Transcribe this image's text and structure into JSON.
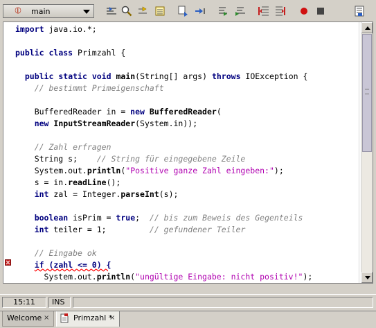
{
  "toolbar": {
    "method_selector": {
      "value": "main",
      "icon": "method-icon"
    },
    "buttons": [
      {
        "name": "find-selection-icon"
      },
      {
        "name": "find-icon"
      },
      {
        "name": "goto-previous-icon"
      },
      {
        "name": "bookmarks-icon"
      },
      {
        "name": "replace-icon"
      },
      {
        "name": "goto-next-icon"
      },
      {
        "name": "shift-left-icon"
      },
      {
        "name": "shift-right-icon"
      },
      {
        "name": "comment-icon"
      },
      {
        "name": "uncomment-icon"
      },
      {
        "name": "record-macro-icon"
      },
      {
        "name": "stop-macro-icon"
      },
      {
        "name": "macro-list-icon"
      }
    ]
  },
  "editor": {
    "lines": [
      {
        "parts": [
          {
            "t": "import",
            "c": "kw"
          },
          {
            "t": " java.io.*;"
          }
        ]
      },
      {
        "parts": []
      },
      {
        "parts": [
          {
            "t": "public",
            "c": "kw"
          },
          {
            "t": " "
          },
          {
            "t": "class",
            "c": "kw"
          },
          {
            "t": " Primzahl {"
          }
        ]
      },
      {
        "parts": []
      },
      {
        "parts": [
          {
            "t": "  "
          },
          {
            "t": "public",
            "c": "kw"
          },
          {
            "t": " "
          },
          {
            "t": "static",
            "c": "kw"
          },
          {
            "t": " "
          },
          {
            "t": "void",
            "c": "kw"
          },
          {
            "t": " "
          },
          {
            "t": "main",
            "c": "mb"
          },
          {
            "t": "(String[] args) "
          },
          {
            "t": "throws",
            "c": "kw"
          },
          {
            "t": " IOException {"
          }
        ]
      },
      {
        "parts": [
          {
            "t": "    "
          },
          {
            "t": "// bestimmt Primeigenschaft",
            "c": "cm"
          }
        ]
      },
      {
        "parts": []
      },
      {
        "parts": [
          {
            "t": "    BufferedReader in = "
          },
          {
            "t": "new",
            "c": "kw"
          },
          {
            "t": " "
          },
          {
            "t": "BufferedReader",
            "c": "mb"
          },
          {
            "t": "("
          }
        ]
      },
      {
        "parts": [
          {
            "t": "    "
          },
          {
            "t": "new",
            "c": "kw"
          },
          {
            "t": " "
          },
          {
            "t": "InputStreamReader",
            "c": "mb"
          },
          {
            "t": "(System.in));"
          }
        ]
      },
      {
        "parts": []
      },
      {
        "parts": [
          {
            "t": "    "
          },
          {
            "t": "// Zahl erfragen",
            "c": "cm"
          }
        ]
      },
      {
        "parts": [
          {
            "t": "    String s;    "
          },
          {
            "t": "// String für eingegebene Zeile",
            "c": "cm"
          }
        ]
      },
      {
        "parts": [
          {
            "t": "    System.out."
          },
          {
            "t": "println",
            "c": "mb"
          },
          {
            "t": "("
          },
          {
            "t": "\"Positive ganze Zahl eingeben:\"",
            "c": "st"
          },
          {
            "t": ");"
          }
        ]
      },
      {
        "parts": [
          {
            "t": "    s = in."
          },
          {
            "t": "readLine",
            "c": "mb"
          },
          {
            "t": "();"
          }
        ]
      },
      {
        "parts": [
          {
            "t": "    "
          },
          {
            "t": "int",
            "c": "kw"
          },
          {
            "t": " zal = Integer."
          },
          {
            "t": "parseInt",
            "c": "mb"
          },
          {
            "t": "(s);"
          }
        ]
      },
      {
        "parts": []
      },
      {
        "parts": [
          {
            "t": "    "
          },
          {
            "t": "boolean",
            "c": "kw"
          },
          {
            "t": " isPrim = "
          },
          {
            "t": "true",
            "c": "kw"
          },
          {
            "t": ";  "
          },
          {
            "t": "// bis zum Beweis des Gegenteils",
            "c": "cm"
          }
        ]
      },
      {
        "parts": [
          {
            "t": "    "
          },
          {
            "t": "int",
            "c": "kw"
          },
          {
            "t": " teiler = 1;         "
          },
          {
            "t": "// gefundener Teiler",
            "c": "cm"
          }
        ]
      },
      {
        "parts": []
      },
      {
        "parts": [
          {
            "t": "    "
          },
          {
            "t": "// Eingabe ok",
            "c": "cm"
          }
        ]
      },
      {
        "parts": [
          {
            "t": "    "
          },
          {
            "t": "if (zahl <= 0) {",
            "c": "kw err-ul"
          }
        ]
      },
      {
        "parts": [
          {
            "t": "      System.out."
          },
          {
            "t": "println",
            "c": "mb"
          },
          {
            "t": "("
          },
          {
            "t": "\"ungültige Eingabe: nicht positiv!\"",
            "c": "st"
          },
          {
            "t": ");"
          }
        ]
      },
      {
        "parts": [
          {
            "t": "    "
          }
        ]
      }
    ],
    "error_line": 21
  },
  "status": {
    "position": "15:11",
    "mode": "INS",
    "message": ""
  },
  "tabs": [
    {
      "label": "Welcome",
      "close": "×",
      "active": false
    },
    {
      "label": "Primzahl *",
      "close": "×",
      "active": true
    }
  ]
}
